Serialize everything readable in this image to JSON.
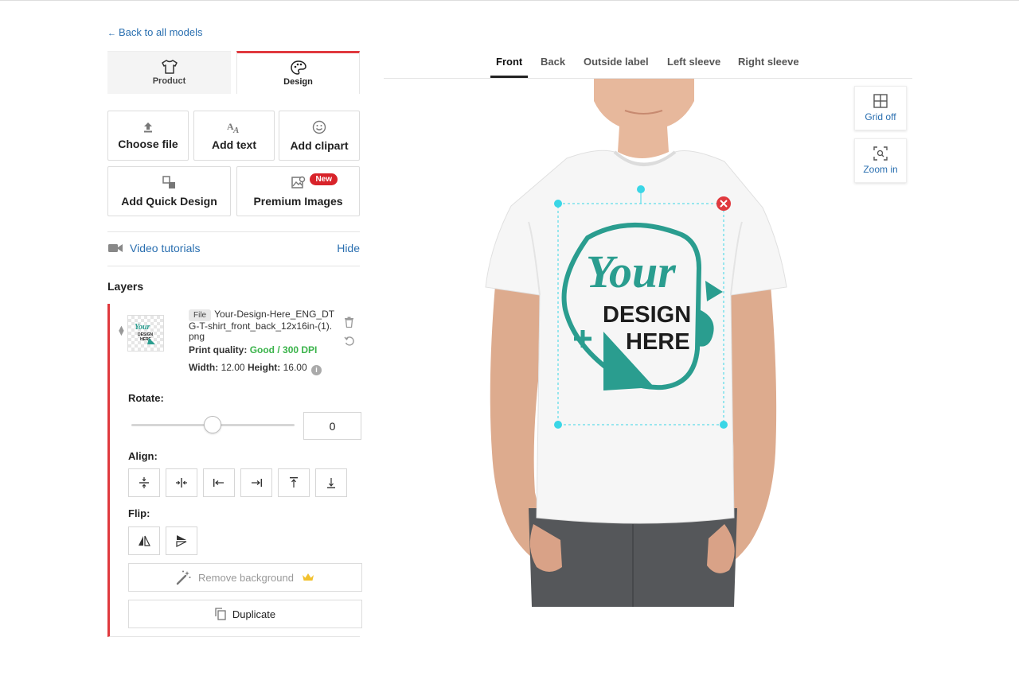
{
  "back_link": "Back to all models",
  "tabs": [
    {
      "label": "Product",
      "icon": "tshirt-icon"
    },
    {
      "label": "Design",
      "icon": "palette-icon",
      "active": true
    }
  ],
  "tools": {
    "choose_file": "Choose file",
    "add_text": "Add text",
    "add_clipart": "Add clipart",
    "quick_design": "Add Quick Design",
    "premium_images": "Premium Images",
    "new_badge": "New"
  },
  "video": {
    "label": "Video tutorials",
    "hide": "Hide"
  },
  "layers": {
    "title": "Layers",
    "file_tag": "File",
    "file_name": "Your-Design-Here_ENG_DTG-T-shirt_front_back_12x16in-(1).png",
    "print_quality_label": "Print quality:",
    "print_quality_value": "Good / 300 DPI",
    "width_label": "Width:",
    "width_value": "12.00",
    "height_label": "Height:",
    "height_value": "16.00",
    "thumb_text_1": "Your",
    "thumb_text_2": "DESIGN",
    "thumb_text_3": "HERE"
  },
  "rotate": {
    "label": "Rotate:",
    "value": "0"
  },
  "align": {
    "label": "Align:"
  },
  "flip": {
    "label": "Flip:"
  },
  "actions": {
    "remove_bg": "Remove background",
    "duplicate": "Duplicate"
  },
  "view_tabs": [
    "Front",
    "Back",
    "Outside label",
    "Left sleeve",
    "Right sleeve"
  ],
  "design": {
    "line1": "Your",
    "line2": "DESIGN",
    "line3": "HERE"
  },
  "side_controls": {
    "grid": "Grid off",
    "zoom": "Zoom in"
  },
  "colors": {
    "accent": "#e0393e",
    "link": "#2a6fb0",
    "good": "#3ab34a",
    "teal": "#2a9d8f",
    "selection": "#3ad6e6"
  }
}
